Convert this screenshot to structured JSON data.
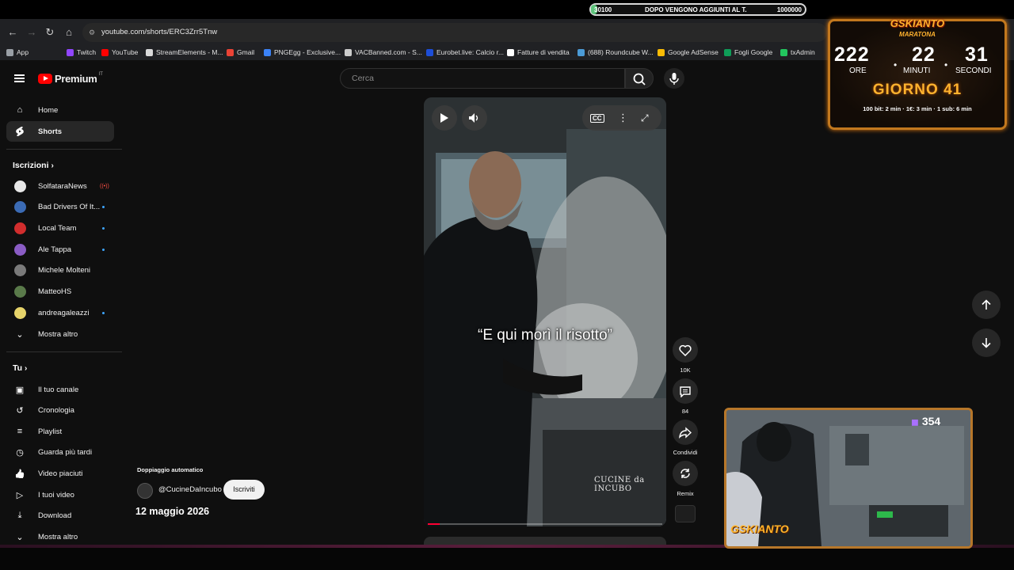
{
  "stream_goal": {
    "current": "30100",
    "message": "DOPO VENGONO AGGIUNTI AL T.",
    "target": "1000000",
    "progress": 0.03
  },
  "browser": {
    "url": "youtube.com/shorts/ERC3Zrr5Tnw",
    "bookmarks": [
      {
        "label": "App",
        "color": "#9aa0a6"
      },
      {
        "label": "Twitch",
        "color": "#9146ff"
      },
      {
        "label": "YouTube",
        "color": "#ff0000"
      },
      {
        "label": "StreamElements - M...",
        "color": "#d9d9d9"
      },
      {
        "label": "Gmail",
        "color": "#ea4335"
      },
      {
        "label": "PNGEgg - Exclusive...",
        "color": "#3b82f6"
      },
      {
        "label": "VACBanned.com - S...",
        "color": "#cccccc"
      },
      {
        "label": "Eurobet.live: Calcio r...",
        "color": "#1d4ed8"
      },
      {
        "label": "Fatture di vendita",
        "color": "#ffffff"
      },
      {
        "label": "(688) Roundcube W...",
        "color": "#4b9bd6"
      },
      {
        "label": "Google AdSense",
        "color": "#fbbc05"
      },
      {
        "label": "Fogli Google",
        "color": "#0f9d58"
      },
      {
        "label": "txAdmin",
        "color": "#22c55e"
      }
    ]
  },
  "youtube": {
    "logo_text": "Premium",
    "logo_region": "IT",
    "search_placeholder": "Cerca",
    "nav": [
      {
        "label": "Home",
        "icon": "home-icon"
      },
      {
        "label": "Shorts",
        "icon": "shorts-icon",
        "active": true
      }
    ],
    "subscriptions_heading": "Iscrizioni",
    "subscriptions": [
      {
        "label": "SolfataraNews",
        "color": "#e8e8e8",
        "indicator": "live"
      },
      {
        "label": "Bad Drivers Of It...",
        "color": "#3b6bb5",
        "indicator": "dot"
      },
      {
        "label": "Local Team",
        "color": "#d12d2d",
        "indicator": "dot"
      },
      {
        "label": "Ale Tappa",
        "color": "#8a5cc4",
        "indicator": "dot"
      },
      {
        "label": "Michele Molteni",
        "color": "#7a7a7a",
        "indicator": "none"
      },
      {
        "label": "MatteoHS",
        "color": "#5a7a4a",
        "indicator": "none"
      },
      {
        "label": "andreagaleazzi",
        "color": "#e6d36a",
        "indicator": "dot"
      }
    ],
    "show_more": "Mostra altro",
    "you_heading": "Tu",
    "you_items": [
      {
        "label": "Il tuo canale",
        "icon": "channel-icon"
      },
      {
        "label": "Cronologia",
        "icon": "history-icon"
      },
      {
        "label": "Playlist",
        "icon": "playlist-icon"
      },
      {
        "label": "Guarda più tardi",
        "icon": "watch-later-icon"
      },
      {
        "label": "Video piaciuti",
        "icon": "like-icon"
      },
      {
        "label": "I tuoi video",
        "icon": "your-videos-icon"
      },
      {
        "label": "Download",
        "icon": "download-icon"
      }
    ],
    "you_show_more": "Mostra altro",
    "short": {
      "caption": "“E qui morì il risotto”",
      "watermark": "CUCINE da INCUBO",
      "progress": 0.05,
      "auto_dubbing": "Doppiaggio automatico",
      "channel": "@CucineDaIncubo",
      "subscribe": "Iscriviti",
      "date": "12 maggio 2026",
      "likes": "10K",
      "comments": "84",
      "share": "Condividi",
      "remix": "Remix"
    }
  },
  "overlay": {
    "brand": "GSKIANTO",
    "subtitle": "MARATONA",
    "hours": "222",
    "minutes": "22",
    "seconds": "31",
    "hours_label": "ORE",
    "minutes_label": "MINUTI",
    "seconds_label": "SECONDI",
    "day": "GIORNO 41",
    "rules": "100 bit: 2 min · 1€: 3 min · 1 sub: 6 min",
    "cam_count": "354",
    "cam_logo": "GSKIANTO"
  }
}
